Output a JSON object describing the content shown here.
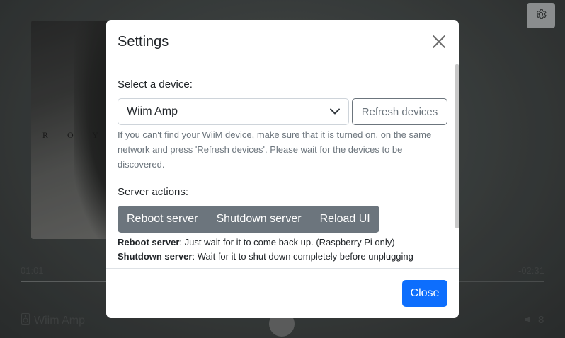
{
  "player": {
    "album_art_text": "R O Y A",
    "elapsed": "01:01",
    "remaining": "-02:31",
    "progress_fraction": 0.29,
    "device_name": "Wiim Amp",
    "volume": "8"
  },
  "modal": {
    "title": "Settings",
    "select_device_label": "Select a device:",
    "selected_device": "Wiim Amp",
    "refresh_label": "Refresh devices",
    "device_help": "If you can't find your WiiM device, make sure that it is turned on, on the same network and press 'Refresh devices'. Please wait for the devices to be discovered.",
    "server_actions_label": "Server actions:",
    "actions": {
      "reboot": "Reboot server",
      "shutdown": "Shutdown server",
      "reload": "Reload UI"
    },
    "notes": {
      "reboot_title": "Reboot server",
      "reboot_text": ": Just wait for it to come back up. (Raspberry Pi only)",
      "shutdown_title": "Shutdown server",
      "shutdown_text": ": Wait for it to shut down completely before unplugging"
    },
    "close_label": "Close"
  },
  "colors": {
    "primary": "#0d6efd",
    "secondary": "#6c757d",
    "overlay_button": "#8a8d8e"
  },
  "icons": [
    "gear-icon",
    "close-icon",
    "chevron-down-icon",
    "speaker-icon",
    "volume-icon"
  ]
}
